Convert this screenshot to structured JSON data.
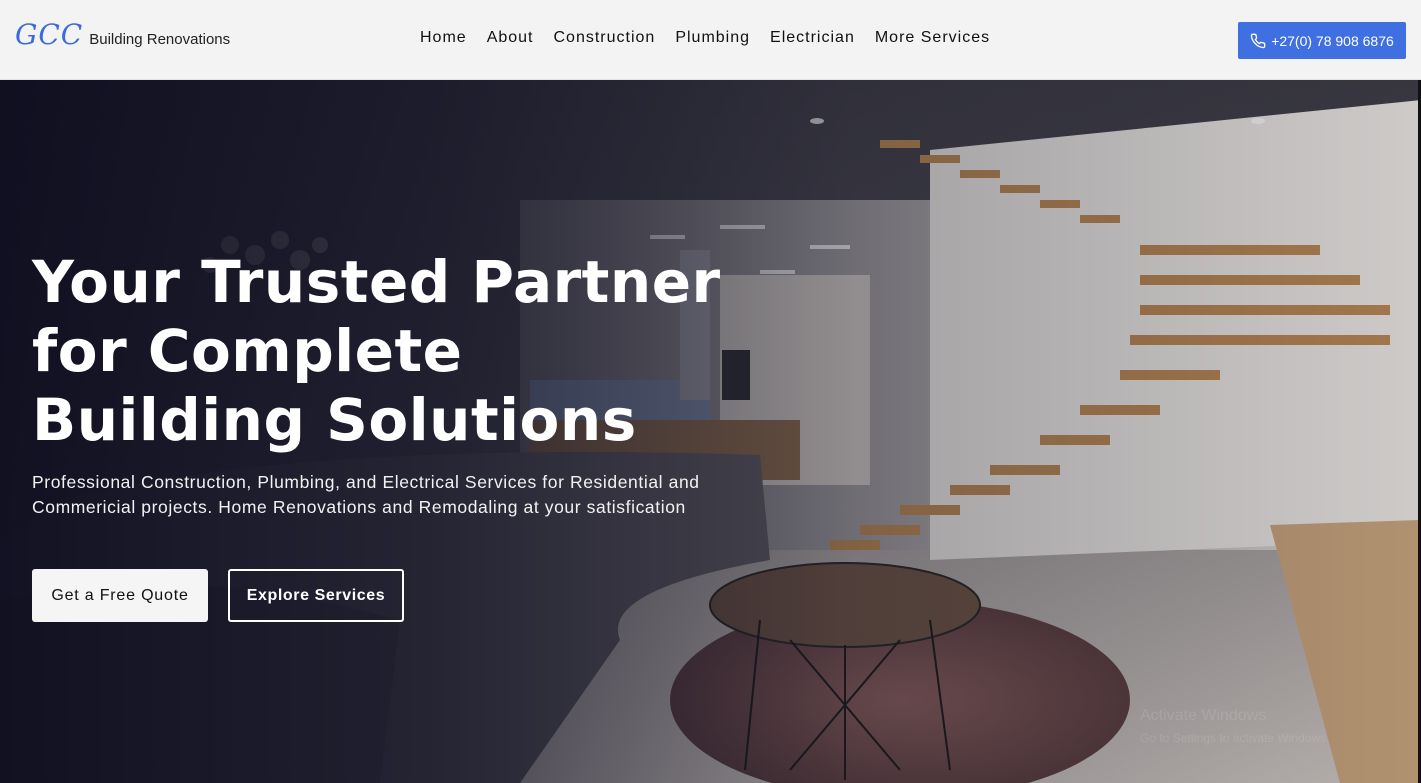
{
  "header": {
    "logo_mark": "GCC",
    "logo_text": "Building Renovations",
    "nav": [
      {
        "label": "Home"
      },
      {
        "label": "About"
      },
      {
        "label": "Construction"
      },
      {
        "label": "Plumbing"
      },
      {
        "label": "Electrician"
      },
      {
        "label": "More Services"
      }
    ],
    "phone": {
      "label": "+27(0) 78 908 6876",
      "icon": "phone-icon"
    }
  },
  "hero": {
    "title": "Your Trusted Partner for Complete Building Solutions",
    "subtitle": "Professional Construction, Plumbing, and Electrical Services for Residential and Commericial projects. Home Renovations and Remodaling at your satisfication",
    "primary_cta": "Get a Free Quote",
    "secondary_cta": "Explore Services"
  },
  "watermark": {
    "line1": "Activate Windows",
    "line2": "Go to Settings to activate Windows."
  },
  "colors": {
    "accent": "#3f6fe0",
    "logo": "#3b6bd8",
    "navbar_bg": "#f3f3f3"
  }
}
